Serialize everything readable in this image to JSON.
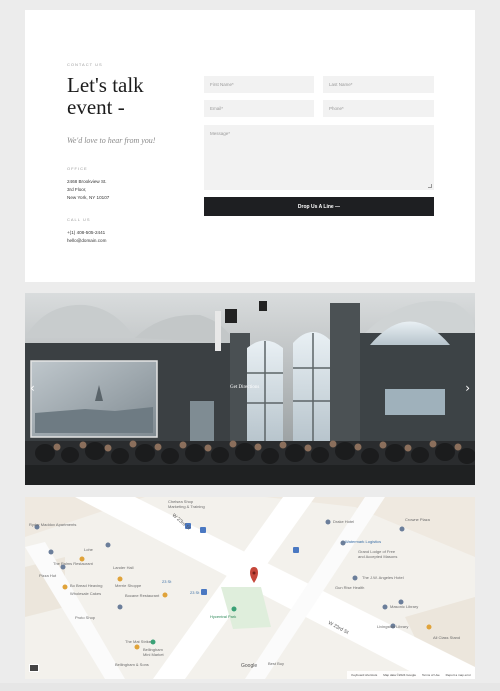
{
  "contact": {
    "eyebrow": "CONTACT US",
    "title": "Let's talk event -",
    "tagline": "We'd love to hear from you!",
    "office_label": "OFFICE",
    "address": [
      "2468 Brookview St.",
      "3rd Floor,",
      "New York, NY 10107"
    ],
    "call_label": "CALL US",
    "phone": "+(1) 408-505-2441",
    "email": "hello@domain.com"
  },
  "form": {
    "first_name": "First Name*",
    "last_name": "Last Name*",
    "email": "Email*",
    "phone": "Phone*",
    "message": "Message*",
    "submit": "Drop Us A Line —"
  },
  "slider": {
    "link": "Get Directions",
    "prev": "‹",
    "next": "›"
  },
  "map": {
    "streets": [
      "W 23rd St",
      "W 22nd St",
      "W 23rd St"
    ],
    "pois": [
      "Chelsea Shop\nMarketing & Training",
      "Ryder Maddox Apartments",
      "Drake Hotel",
      "Watermark Logistics",
      "Grand Lodge of Free\nand Accepted Masons",
      "The J.W. Angeles Hotel",
      "Gun Rise Health",
      "Masonic Library",
      "Livingston Library",
      "Crowne Plaza",
      "Lander Hall",
      "Pizza Hut",
      "The Palms Restaurant",
      "Bo Bread Heaving",
      "Wholesale Cakes",
      "Bocane Restaurant",
      "Lohe",
      "23 St",
      "23 St",
      "Proto Shop",
      "Merrie Shoppe",
      "Hycentral Park",
      "Bellingham\nMini Market",
      "Bellingham & Sons",
      "Best Buy",
      "All Class Stand",
      "The Mat Strike"
    ],
    "google": "Google",
    "footer": [
      "Keyboard shortcuts",
      "Map data ©2024 Google",
      "Terms of Use",
      "Report a map error"
    ]
  }
}
